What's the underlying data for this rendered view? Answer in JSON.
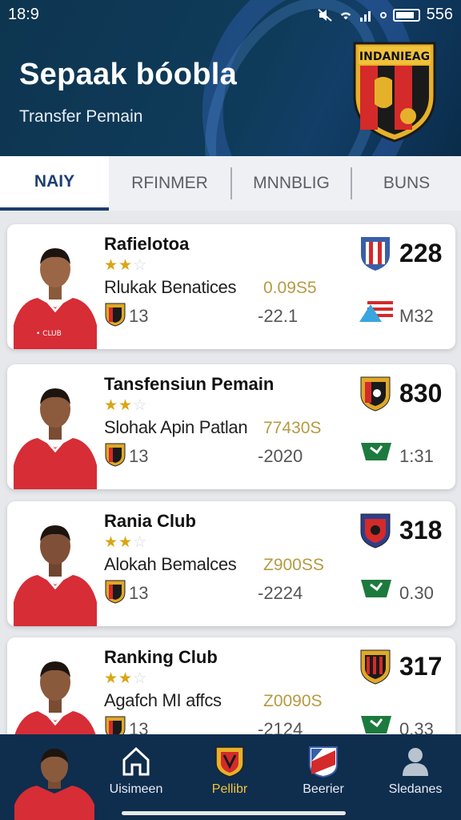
{
  "status": {
    "time": "18:9",
    "battery": "556"
  },
  "header": {
    "title": "Sepaak bóobla",
    "subtitle": "Transfer Pemain",
    "crest_text": "INDANIEAG"
  },
  "tabs": [
    {
      "label": "NAIY",
      "active": true
    },
    {
      "label": "RFINMER",
      "active": false
    },
    {
      "label": "MNNBLIG",
      "active": false
    },
    {
      "label": "BUNS",
      "active": false
    }
  ],
  "cards": [
    {
      "name": "Rafielotoa",
      "stars": 2,
      "club": "Rlukak Benatices",
      "fee": "0.09S5",
      "number": "13",
      "date": "-22.1",
      "score": "228",
      "stat": "M32"
    },
    {
      "name": "Tansfensiun Pemain",
      "stars": 2,
      "club": "Slohak Apin Patlan",
      "fee": "77430S",
      "number": "13",
      "date": "-2020",
      "score": "830",
      "stat": "1:31"
    },
    {
      "name": "Rania Club",
      "stars": 2,
      "club": "Alokah Bemalces",
      "fee": "Z900SS",
      "number": "13",
      "date": "-2224",
      "score": "318",
      "stat": "0.30"
    },
    {
      "name": "Ranking Club",
      "stars": 2,
      "club": "Agafch MI affcs",
      "fee": "Z0090S",
      "number": "13",
      "date": "-2124",
      "score": "317",
      "stat": "0.33"
    }
  ],
  "bottom_nav": [
    {
      "label": "Uisimeen",
      "icon": "home-icon",
      "active": false
    },
    {
      "label": "Pellibr",
      "icon": "shield-icon",
      "active": true
    },
    {
      "label": "Beerier",
      "icon": "flag-icon",
      "active": false
    },
    {
      "label": "Sledanes",
      "icon": "user-icon",
      "active": false
    }
  ],
  "colors": {
    "header": "#0f3b5a",
    "accent": "#1b3b6e",
    "gold": "#b69a43",
    "nav": "#0f2d4d"
  }
}
